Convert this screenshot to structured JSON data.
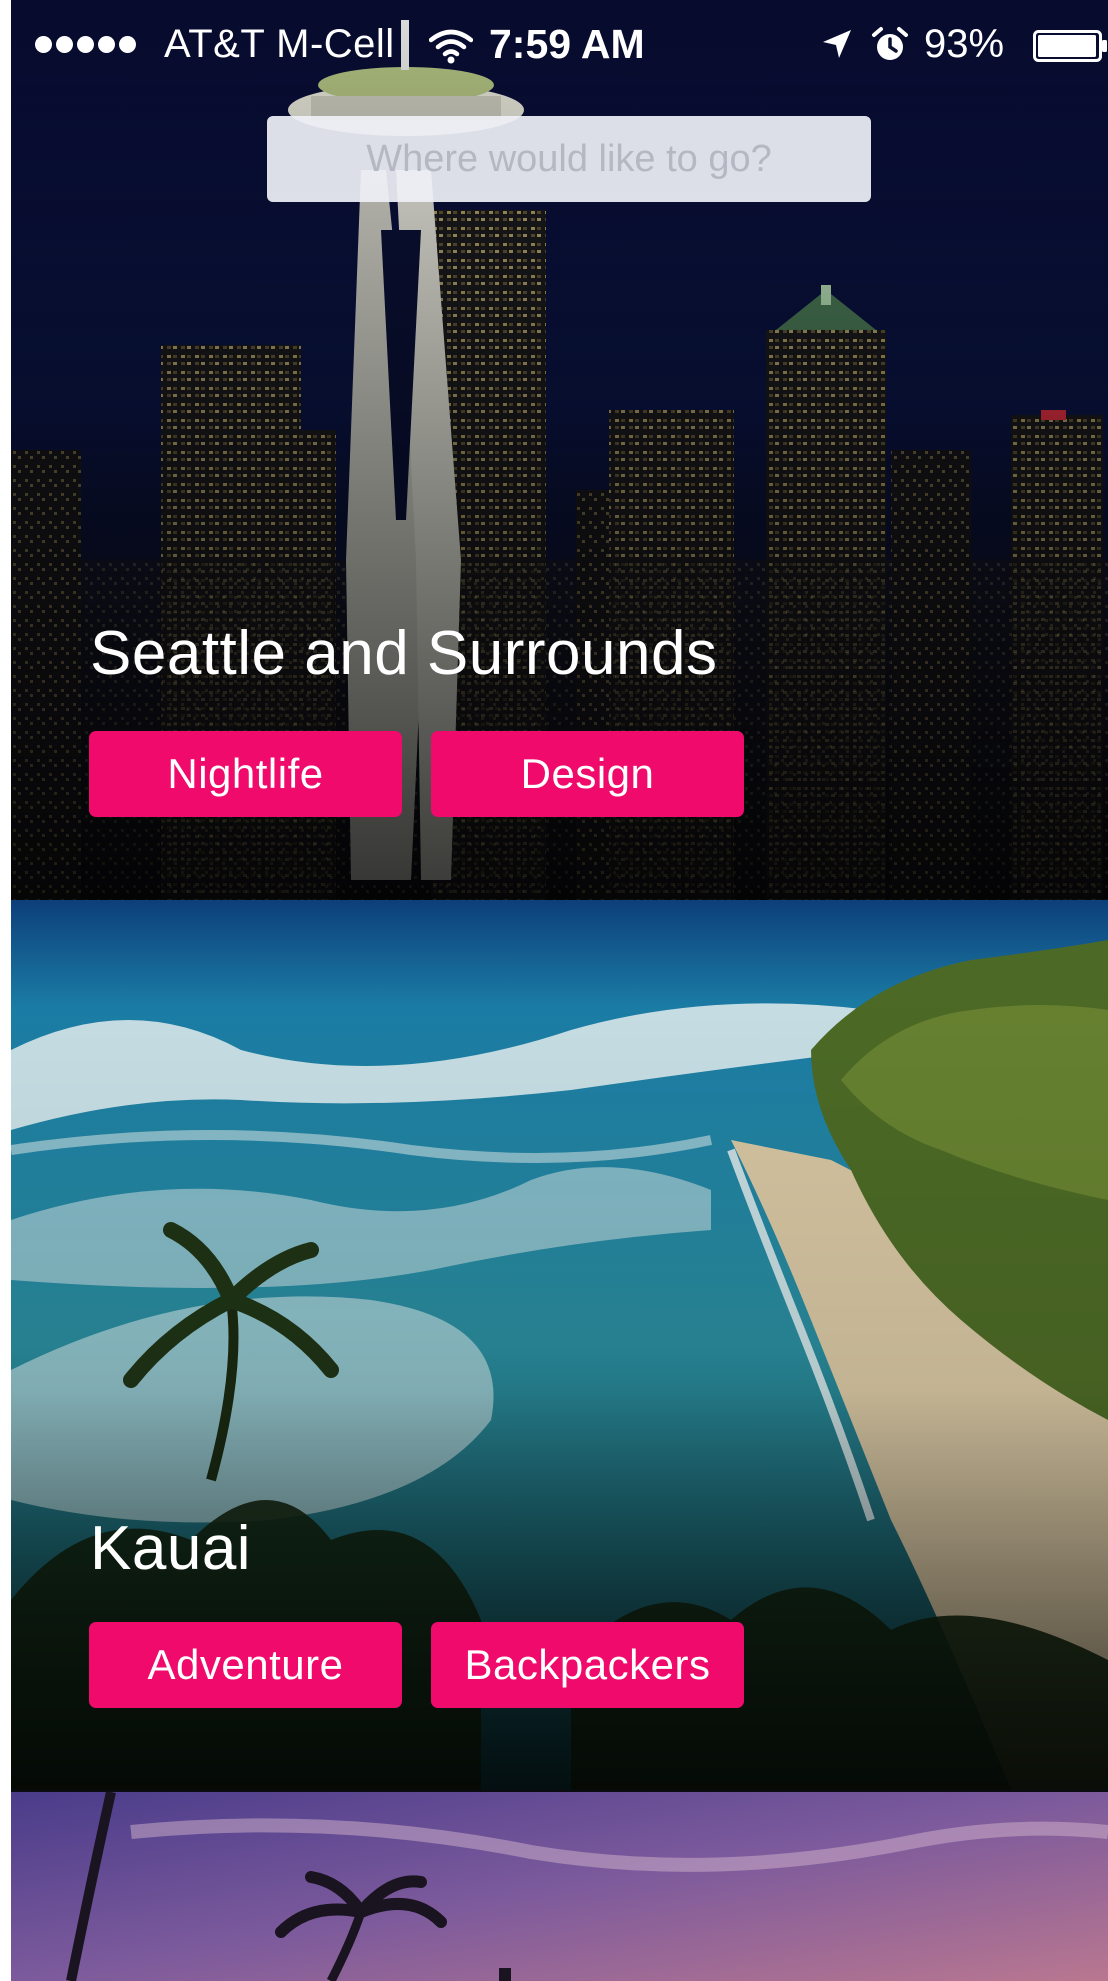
{
  "status_bar": {
    "carrier": "AT&T M-Cell",
    "time": "7:59 AM",
    "battery": "93%",
    "icons": [
      "signal-dots-icon",
      "wifi-icon",
      "location-arrow-icon",
      "alarm-clock-icon",
      "battery-icon"
    ]
  },
  "search": {
    "placeholder": "Where would like to go?"
  },
  "destinations": [
    {
      "title": "Seattle and Surrounds",
      "tags": [
        "Nightlife",
        "Design"
      ]
    },
    {
      "title": "Kauai",
      "tags": [
        "Adventure",
        "Backpackers"
      ]
    }
  ],
  "colors": {
    "tag_background": "#ef0a6c",
    "search_background": "#eef0f6",
    "text": "#ffffff"
  }
}
